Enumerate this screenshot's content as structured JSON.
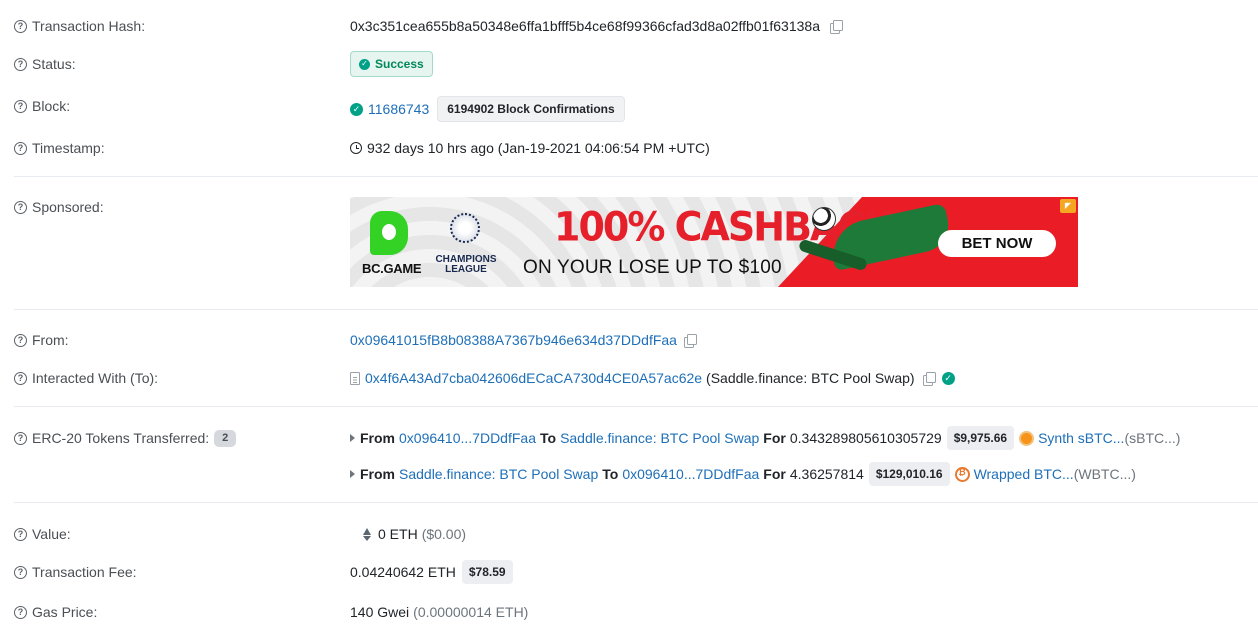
{
  "labels": {
    "tx_hash": "Transaction Hash:",
    "status": "Status:",
    "block": "Block:",
    "timestamp": "Timestamp:",
    "sponsored": "Sponsored:",
    "from": "From:",
    "interacted": "Interacted With (To):",
    "erc20": "ERC-20 Tokens Transferred:",
    "value": "Value:",
    "fee": "Transaction Fee:",
    "gas_price": "Gas Price:"
  },
  "tx_hash": "0x3c351cea655b8a50348e6ffa1bfff5b4ce68f99366cfad3d8a02ffb01f63138a",
  "status": "Success",
  "block": {
    "number": "11686743",
    "confirmations": "6194902 Block Confirmations"
  },
  "timestamp": "932 days 10 hrs ago (Jan-19-2021 04:06:54 PM +UTC)",
  "ad": {
    "brand": "BC.GAME",
    "league": "CHAMPIONS LEAGUE",
    "headline": "100% CASHBACK",
    "sub": "ON YOUR LOSE UP TO $100",
    "cta": "BET NOW"
  },
  "from_address": "0x09641015fB8b08388A7367b946e634d37DDdfFaa",
  "interacted": {
    "address": "0x4f6A43Ad7cba042606dECaCA730d4CE0A57ac62e",
    "name": "(Saddle.finance: BTC Pool Swap)"
  },
  "erc20": {
    "count": "2",
    "transfers": [
      {
        "from_kw": "From",
        "from": "0x096410...7DDdfFaa",
        "to_kw": "To",
        "to": "Saddle.finance: BTC Pool Swap",
        "for_kw": "For",
        "amount": "0.343289805610305729",
        "usd": "$9,975.66",
        "token": "Synth sBTC...",
        "symbol": "(sBTC...)"
      },
      {
        "from_kw": "From",
        "from": "Saddle.finance: BTC Pool Swap",
        "to_kw": "To",
        "to": "0x096410...7DDdfFaa",
        "for_kw": "For",
        "amount": "4.36257814",
        "usd": "$129,010.16",
        "token": "Wrapped BTC...",
        "symbol": "(WBTC...)"
      }
    ]
  },
  "value": {
    "eth": "0 ETH",
    "usd": "($0.00)"
  },
  "fee": {
    "eth": "0.04240642 ETH",
    "usd": "$78.59"
  },
  "gas_price": {
    "gwei": "140 Gwei",
    "eth": "(0.00000014 ETH)"
  },
  "colors": {
    "link": "#1e6fb8",
    "success": "#00a186",
    "ad_red": "#ea1d27"
  }
}
